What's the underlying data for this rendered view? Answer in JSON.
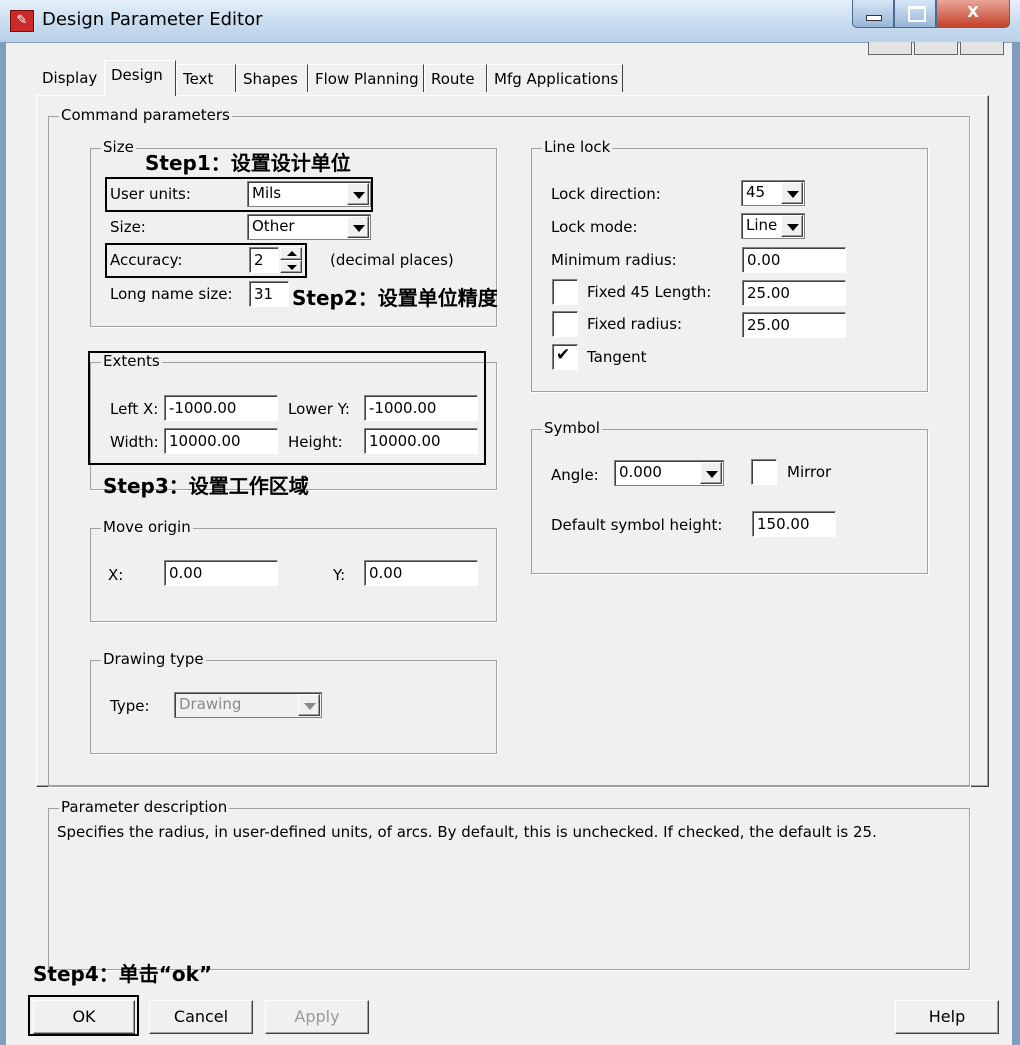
{
  "window": {
    "title": "Design Parameter Editor",
    "minimize_label": "",
    "maximize_label": "",
    "close_label": "X"
  },
  "tabs": [
    {
      "label": "Display"
    },
    {
      "label": "Design"
    },
    {
      "label": "Text"
    },
    {
      "label": "Shapes"
    },
    {
      "label": "Flow Planning"
    },
    {
      "label": "Route"
    },
    {
      "label": "Mfg Applications"
    }
  ],
  "command_parameters": {
    "title": "Command parameters"
  },
  "size": {
    "title": "Size",
    "user_units_label": "User units:",
    "user_units_value": "Mils",
    "size_label": "Size:",
    "size_value": "Other",
    "accuracy_label": "Accuracy:",
    "accuracy_value": "2",
    "decimal_places_label": "(decimal places)",
    "long_name_label": "Long name size:",
    "long_name_value": "31"
  },
  "extents": {
    "title": "Extents",
    "left_x_label": "Left X:",
    "left_x_value": "-1000.00",
    "lower_y_label": "Lower Y:",
    "lower_y_value": "-1000.00",
    "width_label": "Width:",
    "width_value": "10000.00",
    "height_label": "Height:",
    "height_value": "10000.00"
  },
  "move_origin": {
    "title": "Move origin",
    "x_label": "X:",
    "x_value": "0.00",
    "y_label": "Y:",
    "y_value": "0.00"
  },
  "drawing_type": {
    "title": "Drawing type",
    "type_label": "Type:",
    "type_value": "Drawing"
  },
  "line_lock": {
    "title": "Line lock",
    "lock_direction_label": "Lock direction:",
    "lock_direction_value": "45",
    "lock_mode_label": "Lock mode:",
    "lock_mode_value": "Line",
    "min_radius_label": "Minimum radius:",
    "min_radius_value": "0.00",
    "fixed45_label": "Fixed 45 Length:",
    "fixed45_value": "25.00",
    "fixed45_checked": false,
    "fixed_radius_label": "Fixed radius:",
    "fixed_radius_value": "25.00",
    "fixed_radius_checked": false,
    "tangent_label": "Tangent",
    "tangent_checked": true,
    "tangent_mark": "✔"
  },
  "symbol": {
    "title": "Symbol",
    "angle_label": "Angle:",
    "angle_value": "0.000",
    "mirror_label": "Mirror",
    "mirror_checked": false,
    "height_label": "Default symbol height:",
    "height_value": "150.00"
  },
  "parameter_description": {
    "title": "Parameter description",
    "text": "Specifies the radius, in user-defined units, of arcs. By default, this is unchecked. If checked, the default is 25."
  },
  "buttons": {
    "ok": "OK",
    "cancel": "Cancel",
    "apply": "Apply",
    "help": "Help"
  },
  "annotations": {
    "step1": "Step1：设置设计单位",
    "step2": "Step2：设置单位精度",
    "step3": "Step3：设置工作区域",
    "step4": "Step4：单击“ok”"
  }
}
